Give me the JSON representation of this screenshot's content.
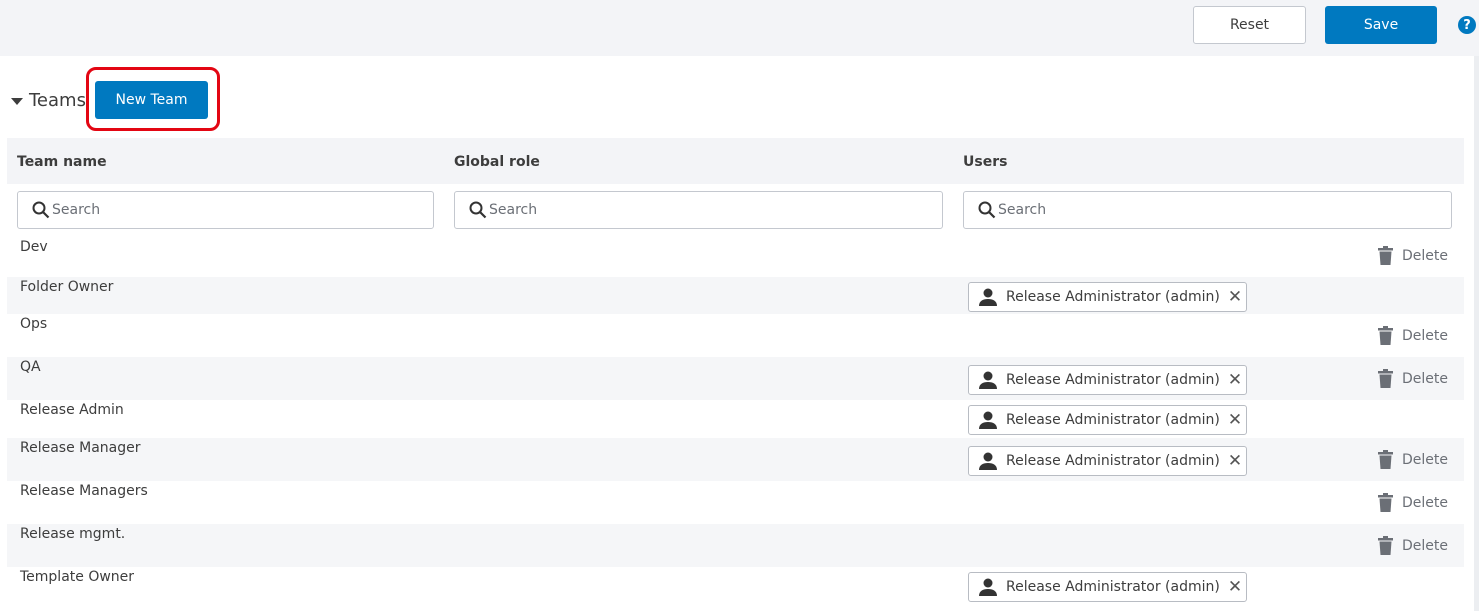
{
  "toolbar": {
    "reset_label": "Reset",
    "save_label": "Save",
    "help_label": "?"
  },
  "section": {
    "title": "Teams",
    "new_team_label": "New Team"
  },
  "table": {
    "columns": [
      "Team name",
      "Global role",
      "Users"
    ],
    "search_placeholder": "Search",
    "delete_label": "Delete",
    "rows": [
      {
        "name": "Dev",
        "users": [],
        "deletable": true
      },
      {
        "name": "Folder Owner",
        "users": [
          "Release Administrator (admin)"
        ],
        "deletable": false
      },
      {
        "name": "Ops",
        "users": [],
        "deletable": true
      },
      {
        "name": "QA",
        "users": [
          "Release Administrator (admin)"
        ],
        "deletable": true
      },
      {
        "name": "Release Admin",
        "users": [
          "Release Administrator (admin)"
        ],
        "deletable": false
      },
      {
        "name": "Release Manager",
        "users": [
          "Release Administrator (admin)"
        ],
        "deletable": true
      },
      {
        "name": "Release Managers",
        "users": [],
        "deletable": true
      },
      {
        "name": "Release mgmt.",
        "users": [],
        "deletable": true
      },
      {
        "name": "Template Owner",
        "users": [
          "Release Administrator (admin)"
        ],
        "deletable": false
      }
    ]
  },
  "colors": {
    "primary": "#0079c0",
    "highlight": "#e30613"
  }
}
